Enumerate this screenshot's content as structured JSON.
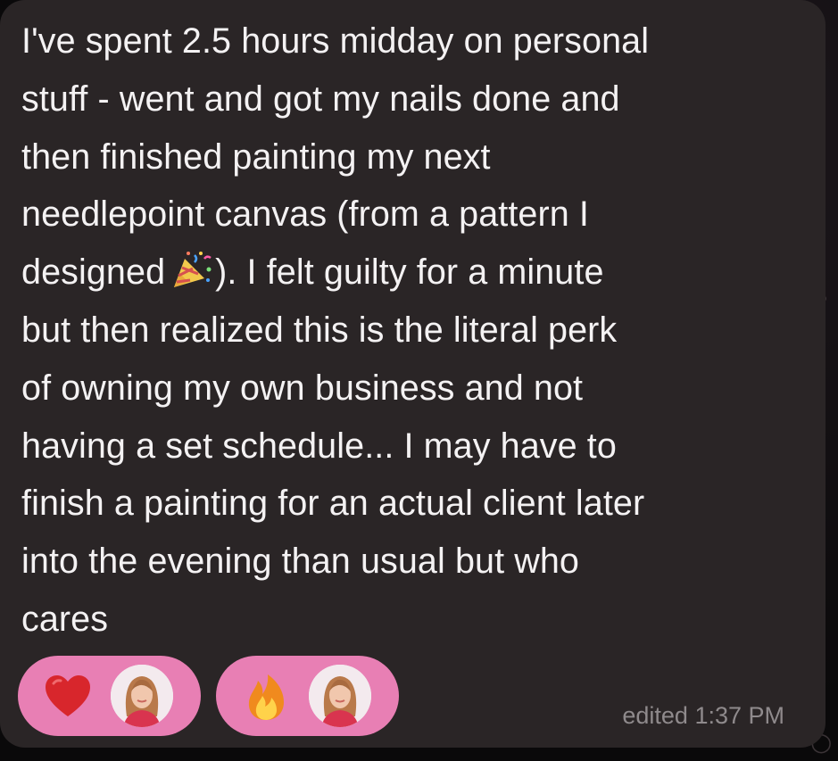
{
  "message": {
    "lines": [
      "I've spent 2.5 hours midday on personal",
      "stuff - went and got my nails done and",
      "then finished painting my next",
      "needlepoint canvas (from a pattern I",
      "designed",
      "). I felt guilty for a minute",
      "but then realized this is the literal perk",
      "of owning my own business and not",
      "having a set schedule... I may have to",
      "finish a painting for an actual client later",
      "into the evening than usual but who",
      "cares"
    ],
    "inline_emoji": "party-popper-icon",
    "status": "edited 1:37 PM"
  },
  "reactions": [
    {
      "emoji": "heart-icon",
      "color": "#d8262c"
    },
    {
      "emoji": "fire-icon",
      "color": "#f08a1e"
    }
  ],
  "colors": {
    "bubble": "#2a2526",
    "text": "#f4f2f3",
    "reaction_pill": "#e87fb4",
    "timestamp": "#8f8a8c",
    "background": "#0b0a0b"
  }
}
